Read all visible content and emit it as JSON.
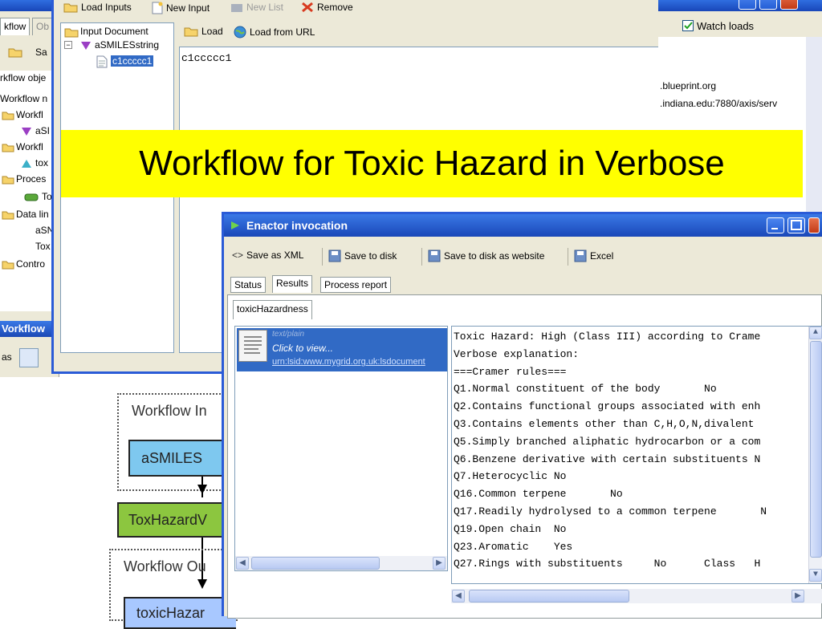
{
  "background_window": {
    "tabs": [
      "kflow",
      "Ob"
    ],
    "toolbar": [
      "Sa"
    ],
    "tree": [
      "rkflow obje",
      "Workflow n",
      "Workfl",
      "aSI",
      "Workfl",
      "tox",
      "Proces",
      "To",
      "Data lin",
      "aSN",
      "Tox",
      "Contro"
    ],
    "blue_bar_label": "Vorkflow",
    "bottom_label": "as"
  },
  "input_window": {
    "toolbar": {
      "load_inputs": "Load Inputs",
      "new_input": "New Input",
      "new_list": "New List",
      "remove": "Remove"
    },
    "tree": {
      "root": "Input Document",
      "input_name": "aSMILESstring",
      "value_node": "c1ccccc1"
    },
    "right_toolbar": {
      "load": "Load",
      "load_url": "Load from URL"
    },
    "text_value": "c1ccccc1"
  },
  "right_window": {
    "watch_loads": "Watch loads",
    "list_items": [
      ".blueprint.org",
      ".indiana.edu:7880/axis/serv"
    ]
  },
  "banner_title": "Workflow for Toxic Hazard in Verbose",
  "diagram": {
    "inputs_label": "Workflow In",
    "input_node": "aSMILES",
    "processor_node": "ToxHazardV",
    "outputs_label": "Workflow Ou",
    "output_node": "toxicHazar"
  },
  "enactor": {
    "title": "Enactor invocation",
    "toolbar": {
      "save_xml": "Save as XML",
      "save_disk": "Save to disk",
      "save_website": "Save to disk as website",
      "excel": "Excel"
    },
    "tabs": [
      "Status",
      "Results",
      "Process report"
    ],
    "result_tab": "toxicHazardness",
    "list_item": {
      "type": "text/plain",
      "click": "Click to view...",
      "lsid": "urn:lsid:www.mygrid.org.uk:lsdocument"
    },
    "result_lines": [
      "Toxic Hazard: High (Class III) according to Crame",
      "Verbose explanation:",
      "===Cramer rules===",
      "Q1.Normal constituent of the body       No",
      "Q2.Contains functional groups associated with enh",
      "Q3.Contains elements other than C,H,O,N,divalent",
      "Q5.Simply branched aliphatic hydrocarbon or a com",
      "Q6.Benzene derivative with certain substituents N",
      "Q7.Heterocyclic No",
      "Q16.Common terpene       No",
      "Q17.Readily hydrolysed to a common terpene       N",
      "Q19.Open chain  No",
      "Q23.Aromatic    Yes",
      "Q27.Rings with substituents     No      Class   H"
    ]
  },
  "colors": {
    "xp_blue": "#2a5bd7",
    "banner_yellow": "#ffff00",
    "input_node_fill": "#7ec8ef",
    "processor_node_fill": "#8cc63f",
    "output_node_fill": "#a8c8ff",
    "selection_blue": "#316ac5"
  }
}
